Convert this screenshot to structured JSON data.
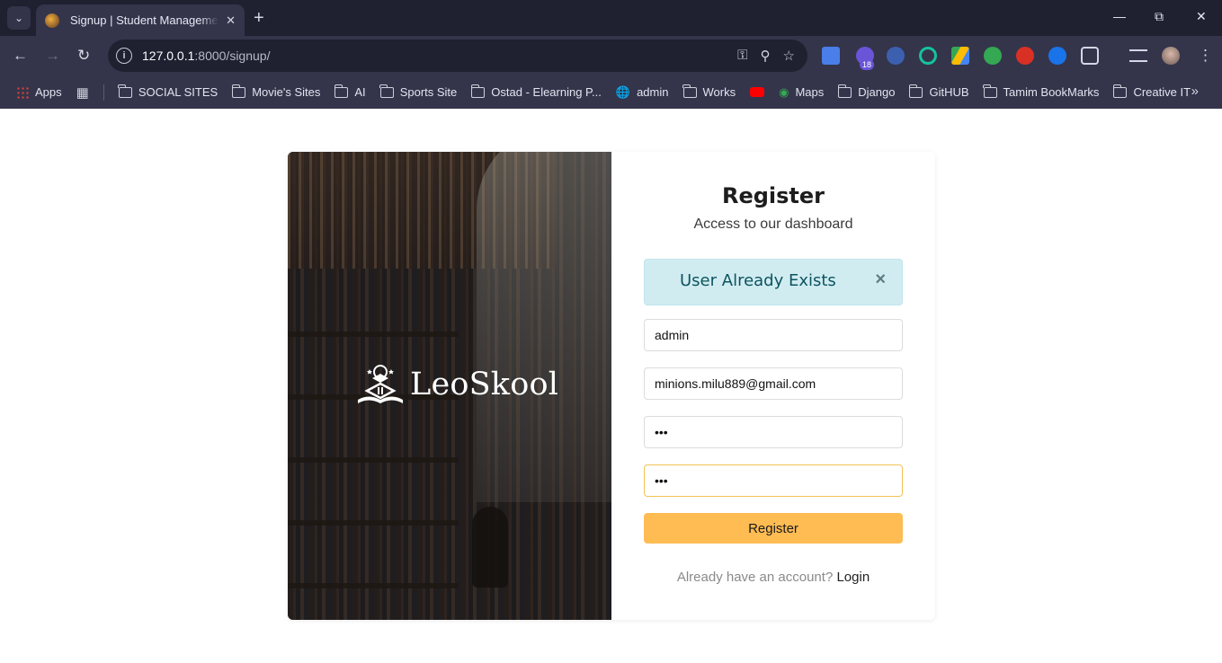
{
  "browser": {
    "tab_title": "Signup | Student Management System",
    "url_host": "127.0.0.1",
    "url_path": ":8000/signup/",
    "extension_badge": "18",
    "bookmarks": [
      {
        "label": "Apps",
        "icon": "apps-icon"
      },
      {
        "label": "SOCIAL SITES",
        "icon": "folder-icon"
      },
      {
        "label": "Movie's Sites",
        "icon": "folder-icon"
      },
      {
        "label": "AI",
        "icon": "folder-icon"
      },
      {
        "label": "Sports Site",
        "icon": "folder-icon"
      },
      {
        "label": "Ostad - Elearning P...",
        "icon": "folder-icon"
      },
      {
        "label": "admin",
        "icon": "globe-icon"
      },
      {
        "label": "Works",
        "icon": "folder-icon"
      },
      {
        "label": "",
        "icon": "youtube-icon"
      },
      {
        "label": "Maps",
        "icon": "maps-icon"
      },
      {
        "label": "Django",
        "icon": "folder-icon"
      },
      {
        "label": "GitHUB",
        "icon": "folder-icon"
      },
      {
        "label": "Tamim BookMarks",
        "icon": "folder-icon"
      },
      {
        "label": "Creative IT",
        "icon": "folder-icon"
      }
    ]
  },
  "brand": {
    "name": "LeoSkool"
  },
  "form": {
    "title": "Register",
    "subtitle": "Access to our dashboard",
    "alert_text": "User Already Exists",
    "alert_close": "×",
    "username_value": "admin",
    "email_value": "minions.milu889@gmail.com",
    "password_value": "abc",
    "confirm_password_value": "abc",
    "submit_label": "Register",
    "login_prompt": "Already have an account?",
    "login_link": "Login"
  }
}
